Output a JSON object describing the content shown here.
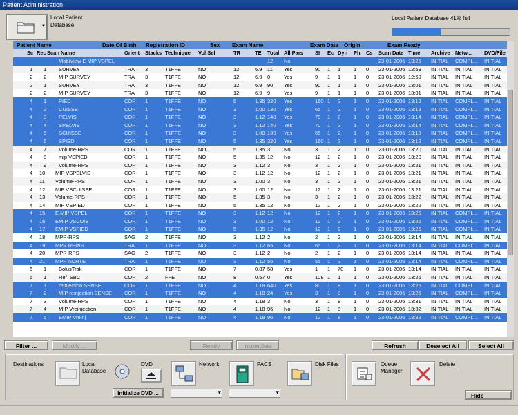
{
  "window": {
    "title": "Patient Administration"
  },
  "topbar": {
    "source_label_line1": "Local Patient",
    "source_label_line2": "Database",
    "db_fill_label": "Local Patient Database 41% full",
    "db_fill_percent": 41
  },
  "table": {
    "group_headers": [
      "Patient Name",
      "Date Of Birth",
      "Registration ID",
      "Sex",
      "Exam Name",
      "Exam Date",
      "Origin",
      "Exam Ready"
    ],
    "columns": [
      "Sc",
      "Rec",
      "Scan Name",
      "Orient",
      "Stacks",
      "Technique",
      "Vol Sel",
      "TR",
      "TE",
      "Total",
      "All Pars",
      "SI",
      "Ec",
      "Dyn",
      "Ph",
      "Cs",
      "Scan Date",
      "Time",
      "Archive",
      "Netw...",
      "DVD/File"
    ],
    "rows": [
      {
        "sel": true,
        "c": [
          "",
          "",
          "MobiView E MIP VSPEL",
          "",
          "",
          "",
          "",
          "",
          "",
          "12",
          "No",
          "",
          "",
          "",
          "",
          "",
          "23-01-2006",
          "13:25",
          "INITIAL",
          "COMPL...",
          "INITIAL"
        ]
      },
      {
        "sel": false,
        "c": [
          "1",
          "1",
          "SURVEY",
          "TRA",
          "3",
          "T1FFE",
          "NO",
          "12",
          "6.9",
          "11",
          "Yes",
          "90",
          "1",
          "1",
          "1",
          "0",
          "23-01-2006",
          "12:59",
          "INITIAL",
          "INITIAL",
          "INITIAL"
        ]
      },
      {
        "sel": false,
        "c": [
          "2",
          "2",
          "MIP SURVEY",
          "TRA",
          "3",
          "T1FFE",
          "NO",
          "12",
          "6.9",
          "0",
          "Yes",
          "9",
          "1",
          "1",
          "1",
          "0",
          "23-01-2006",
          "12:59",
          "INITIAL",
          "INITIAL",
          "INITIAL"
        ]
      },
      {
        "sel": false,
        "c": [
          "2",
          "1",
          "SURVEY",
          "TRA",
          "3",
          "T1FFE",
          "NO",
          "12",
          "6.9",
          "90",
          "Yes",
          "90",
          "1",
          "1",
          "1",
          "0",
          "23-01-2006",
          "13:01",
          "INITIAL",
          "INITIAL",
          "INITIAL"
        ]
      },
      {
        "sel": false,
        "c": [
          "2",
          "2",
          "MIP SURVEY",
          "TRA",
          "3",
          "T1FFE",
          "NO",
          "12",
          "6.9",
          "9",
          "Yes",
          "9",
          "1",
          "1",
          "1",
          "0",
          "23-01-2006",
          "13:01",
          "INITIAL",
          "INITIAL",
          "INITIAL"
        ]
      },
      {
        "sel": true,
        "c": [
          "4",
          "1",
          "PIED",
          "COR",
          "1",
          "T1FFE",
          "NO",
          "5",
          "1.35",
          "320",
          "Yes",
          "160",
          "1",
          "2",
          "1",
          "0",
          "23-01-2006",
          "13:12",
          "INITIAL",
          "COMPL...",
          "INITIAL"
        ]
      },
      {
        "sel": true,
        "c": [
          "4",
          "2",
          "CUISSE",
          "COR",
          "1",
          "T1FFE",
          "NO",
          "3",
          "1.00",
          "130",
          "Yes",
          "65",
          "1",
          "2",
          "1",
          "0",
          "23-01-2006",
          "13:13",
          "INITIAL",
          "COMPL...",
          "INITIAL"
        ]
      },
      {
        "sel": true,
        "c": [
          "4",
          "3",
          "PELVIS",
          "COR",
          "1",
          "T1FFE",
          "NO",
          "3",
          "1.12",
          "140",
          "Yes",
          "70",
          "1",
          "2",
          "1",
          "0",
          "23-01-2006",
          "13:14",
          "INITIAL",
          "COMPL...",
          "INITIAL"
        ]
      },
      {
        "sel": true,
        "c": [
          "4",
          "4",
          "SPELVIS",
          "COR",
          "1",
          "T1FFE",
          "NO",
          "3",
          "1.12",
          "140",
          "Yes",
          "70",
          "1",
          "2",
          "1",
          "0",
          "23-01-2006",
          "13:14",
          "INITIAL",
          "COMPL...",
          "INITIAL"
        ]
      },
      {
        "sel": true,
        "c": [
          "4",
          "5",
          "SCUISSE",
          "COR",
          "1",
          "T1FFE",
          "NO",
          "3",
          "1.00",
          "130",
          "Yes",
          "65",
          "1",
          "2",
          "1",
          "0",
          "23-01-2006",
          "13:13",
          "INITIAL",
          "COMPL...",
          "INITIAL"
        ]
      },
      {
        "sel": true,
        "c": [
          "4",
          "6",
          "SPIED",
          "COR",
          "1",
          "T1FFE",
          "NO",
          "5",
          "1.35",
          "320",
          "Yes",
          "160",
          "1",
          "2",
          "1",
          "0",
          "23-01-2006",
          "13:12",
          "INITIAL",
          "COMPL...",
          "INITIAL"
        ]
      },
      {
        "sel": false,
        "c": [
          "4",
          "7",
          "Volume-RPS",
          "COR",
          "1",
          "T1FFE",
          "NO",
          "5",
          "1.35",
          "3",
          "No",
          "3",
          "1",
          "2",
          "1",
          "0",
          "23-01-2006",
          "13:20",
          "INITIAL",
          "INITIAL",
          "INITIAL"
        ]
      },
      {
        "sel": false,
        "c": [
          "4",
          "8",
          "mip VSPIED",
          "COR",
          "1",
          "T1FFE",
          "NO",
          "5",
          "1.35",
          "12",
          "No",
          "12",
          "1",
          "2",
          "1",
          "0",
          "23-01-2006",
          "13:20",
          "INITIAL",
          "INITIAL",
          "INITIAL"
        ]
      },
      {
        "sel": false,
        "c": [
          "4",
          "9",
          "Volume-RPS",
          "COR",
          "1",
          "T1FFE",
          "NO",
          "3",
          "1.12",
          "3",
          "No",
          "3",
          "1",
          "2",
          "1",
          "0",
          "23-01-2006",
          "13:21",
          "INITIAL",
          "INITIAL",
          "INITIAL"
        ]
      },
      {
        "sel": false,
        "c": [
          "4",
          "10",
          "MIP VSPELVIS",
          "COR",
          "1",
          "T1FFE",
          "NO",
          "3",
          "1.12",
          "12",
          "No",
          "12",
          "1",
          "2",
          "1",
          "0",
          "23-01-2006",
          "13:21",
          "INITIAL",
          "INITIAL",
          "INITIAL"
        ]
      },
      {
        "sel": false,
        "c": [
          "4",
          "11",
          "Volume-RPS",
          "COR",
          "1",
          "T1FFE",
          "NO",
          "3",
          "1.00",
          "3",
          "No",
          "3",
          "1",
          "2",
          "1",
          "0",
          "23-01-2006",
          "13:21",
          "INITIAL",
          "INITIAL",
          "INITIAL"
        ]
      },
      {
        "sel": false,
        "c": [
          "4",
          "12",
          "MIP VSCUISSE",
          "COR",
          "1",
          "T1FFE",
          "NO",
          "3",
          "1.00",
          "12",
          "No",
          "12",
          "1",
          "2",
          "1",
          "0",
          "23-01-2006",
          "13:21",
          "INITIAL",
          "INITIAL",
          "INITIAL"
        ]
      },
      {
        "sel": false,
        "c": [
          "4",
          "13",
          "Volume-RPS",
          "COR",
          "1",
          "T1FFE",
          "NO",
          "5",
          "1.35",
          "3",
          "No",
          "3",
          "1",
          "2",
          "1",
          "0",
          "23-01-2006",
          "13:22",
          "INITIAL",
          "INITIAL",
          "INITIAL"
        ]
      },
      {
        "sel": false,
        "c": [
          "4",
          "14",
          "MIP VSPIED",
          "COR",
          "1",
          "T1FFE",
          "NO",
          "5",
          "1.35",
          "12",
          "No",
          "12",
          "1",
          "2",
          "1",
          "0",
          "23-01-2006",
          "13:22",
          "INITIAL",
          "INITIAL",
          "INITIAL"
        ]
      },
      {
        "sel": true,
        "c": [
          "4",
          "15",
          "E MIP VSPEL",
          "COR",
          "1",
          "T1FFE",
          "NO",
          "3",
          "1.12",
          "12",
          "No",
          "12",
          "1",
          "2",
          "1",
          "0",
          "23-01-2006",
          "13:25",
          "INITIAL",
          "COMPL...",
          "INITIAL"
        ]
      },
      {
        "sel": true,
        "c": [
          "4",
          "16",
          "EMIP VSCUIS",
          "COR",
          "1",
          "T1FFE",
          "NO",
          "3",
          "1.00",
          "12",
          "No",
          "12",
          "1",
          "2",
          "1",
          "0",
          "23-01-2006",
          "13:25",
          "INITIAL",
          "COMPL...",
          "INITIAL"
        ]
      },
      {
        "sel": true,
        "c": [
          "4",
          "17",
          "EMIP VSPIED",
          "COR",
          "1",
          "T1FFE",
          "NO",
          "5",
          "1.35",
          "12",
          "No",
          "12",
          "1",
          "2",
          "1",
          "0",
          "23-01-2006",
          "13:26",
          "INITIAL",
          "COMPL...",
          "INITIAL"
        ]
      },
      {
        "sel": false,
        "c": [
          "4",
          "18",
          "MPR-RPS",
          "SAG",
          "2",
          "T1FFE",
          "NO",
          "3",
          "1.12",
          "2",
          "No",
          "2",
          "1",
          "2",
          "1",
          "0",
          "23-01-2006",
          "13:14",
          "INITIAL",
          "INITIAL",
          "INITIAL"
        ]
      },
      {
        "sel": true,
        "c": [
          "4",
          "19",
          "MPR REINS",
          "TRA",
          "1",
          "T1FFE",
          "NO",
          "3",
          "1.12",
          "65",
          "No",
          "65",
          "1",
          "2",
          "1",
          "0",
          "23-01-2006",
          "13:14",
          "INITIAL",
          "COMPL...",
          "INITIAL"
        ]
      },
      {
        "sel": false,
        "c": [
          "4",
          "20",
          "MPR-RPS",
          "SAG",
          "2",
          "T1FFE",
          "NO",
          "3",
          "1.12",
          "2",
          "No",
          "2",
          "1",
          "2",
          "1",
          "0",
          "23-01-2006",
          "13:14",
          "INITIAL",
          "INITIAL",
          "INITIAL"
        ]
      },
      {
        "sel": true,
        "c": [
          "4",
          "21",
          "MPR AORTE",
          "TRA",
          "1",
          "T1FFE",
          "NO",
          "3",
          "1.12",
          "55",
          "No",
          "55",
          "1",
          "2",
          "1",
          "0",
          "23-01-2006",
          "13:14",
          "INITIAL",
          "COMPL...",
          "INITIAL"
        ]
      },
      {
        "sel": false,
        "c": [
          "5",
          "1",
          "BolusTrak",
          "COR",
          "1",
          "T1FFE",
          "NO",
          "7",
          "0.87",
          "58",
          "Yes",
          "1",
          "1",
          "70",
          "1",
          "0",
          "23-01-2006",
          "13:14",
          "INITIAL",
          "INITIAL",
          "INITIAL"
        ]
      },
      {
        "sel": false,
        "c": [
          "6",
          "1",
          "Ref_SBC",
          "COR",
          "2",
          "FFE",
          "NO",
          "8",
          "0.57",
          "0",
          "Yes",
          "108",
          "1",
          "1",
          "1",
          "0",
          "23-01-2006",
          "13:26",
          "INITIAL",
          "INITIAL",
          "INITIAL"
        ]
      },
      {
        "sel": true,
        "c": [
          "7",
          "1",
          "reinjection SENSE",
          "COR",
          "1",
          "T1FFE",
          "NO",
          "4",
          "1.18",
          "640",
          "Yes",
          "80",
          "1",
          "8",
          "1",
          "0",
          "23-01-2006",
          "13:26",
          "INITIAL",
          "COMPL...",
          "INITIAL"
        ]
      },
      {
        "sel": true,
        "c": [
          "7",
          "2",
          "MIP reinjection SENSE",
          "COR",
          "1",
          "T1FFE",
          "NO",
          "4",
          "1.18",
          "24",
          "Yes",
          "3",
          "1",
          "8",
          "1",
          "0",
          "23-01-2006",
          "13:26",
          "INITIAL",
          "COMPL...",
          "INITIAL"
        ]
      },
      {
        "sel": false,
        "c": [
          "7",
          "3",
          "Volume-RPS",
          "COR",
          "1",
          "T1FFE",
          "NO",
          "4",
          "1.18",
          "3",
          "No",
          "3",
          "1",
          "8",
          "1",
          "0",
          "23-01-2006",
          "13:31",
          "INITIAL",
          "INITIAL",
          "INITIAL"
        ]
      },
      {
        "sel": false,
        "c": [
          "7",
          "4",
          "MIP Vreinjection",
          "COR",
          "1",
          "T1FFE",
          "NO",
          "4",
          "1.18",
          "96",
          "No",
          "12",
          "1",
          "8",
          "1",
          "0",
          "23-01-2006",
          "13:32",
          "INITIAL",
          "INITIAL",
          "INITIAL"
        ]
      },
      {
        "sel": true,
        "c": [
          "7",
          "5",
          "EMIP Vreinj",
          "COR",
          "1",
          "T1FFE",
          "NO",
          "4",
          "1.18",
          "96",
          "No",
          "12",
          "1",
          "8",
          "1",
          "0",
          "23-01-2006",
          "13:32",
          "INITIAL",
          "COMPL...",
          "INITIAL"
        ]
      }
    ]
  },
  "actions": {
    "filter": "Filter ...",
    "modify": "Modify ...",
    "ready": "Ready",
    "incomplete": "Incomplete",
    "refresh": "Refresh",
    "deselect_all": "Deselect All",
    "select_all": "Select All"
  },
  "destinations": {
    "title": "Destinations",
    "local_db_line1": "Local",
    "local_db_line2": "Database",
    "dvd": "DVD",
    "network": "Network",
    "pacs": "PACS",
    "disk_files": "Disk Files",
    "initialize_dvd": "Initialize DVD ..."
  },
  "queue": {
    "queue_line1": "Queue",
    "queue_line2": "Manager",
    "delete": "Delete",
    "hide": "Hide"
  },
  "colors": {
    "selection": "#3b78d6",
    "header": "#5a8ed6",
    "fill": "#3d7ad8"
  }
}
